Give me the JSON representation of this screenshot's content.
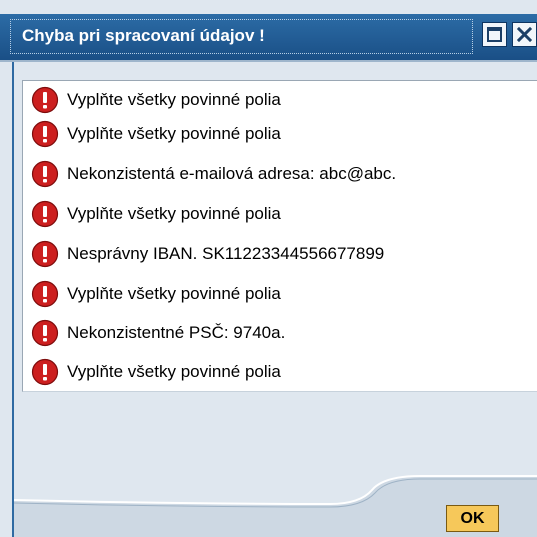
{
  "dialog": {
    "title": "Chyba pri spracovaní údajov !",
    "maximize_icon": "maximize-icon",
    "close_icon": "close-icon"
  },
  "messages": [
    {
      "text": "Vyplňte všetky povinné polia",
      "icon": "error-icon"
    },
    {
      "text": "Vyplňte všetky povinné polia",
      "icon": "error-icon"
    },
    {
      "text": "Nekonzistentá e-mailová adresa: abc@abc.",
      "icon": "error-icon"
    },
    {
      "text": "Vyplňte všetky povinné polia",
      "icon": "error-icon"
    },
    {
      "text": "Nesprávny IBAN. SK11223344556677899",
      "icon": "error-icon"
    },
    {
      "text": "Vyplňte všetky povinné polia",
      "icon": "error-icon"
    },
    {
      "text": "Nekonzistentné PSČ: 9740a.",
      "icon": "error-icon"
    },
    {
      "text": "Vyplňte všetky povinné polia",
      "icon": "error-icon"
    }
  ],
  "footer": {
    "ok_label": "OK"
  },
  "colors": {
    "titlebar": "#1f5b94",
    "error_icon": "#cc1f1f",
    "ok_button": "#f6c85a",
    "window_bg": "#dfe7ef"
  }
}
